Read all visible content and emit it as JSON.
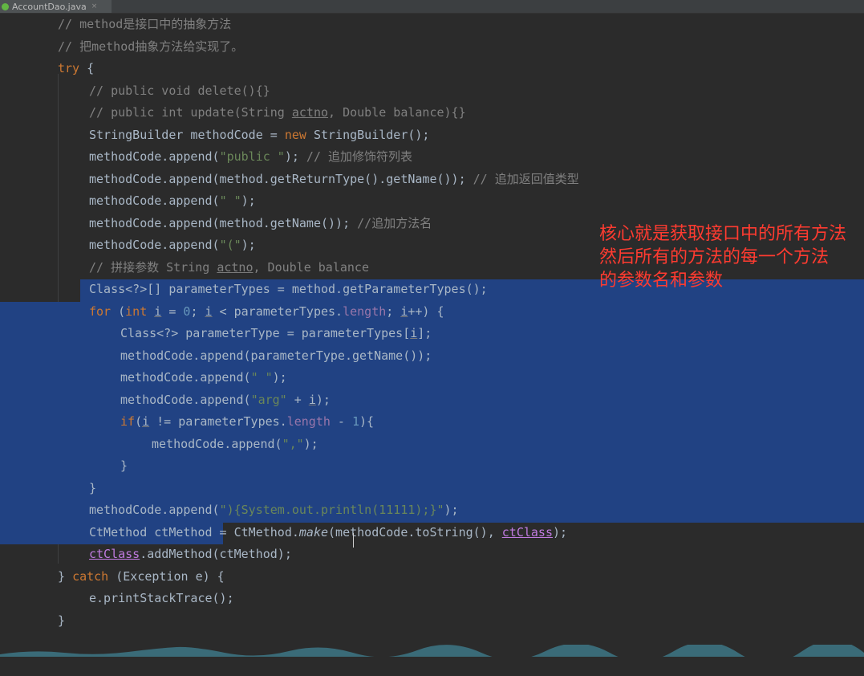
{
  "tab": {
    "filename": "AccountDao.java",
    "close": "×"
  },
  "annotation": {
    "line1": "核心就是获取接口中的所有方法",
    "line2": "然后所有的方法的每一个方法",
    "line3": "的参数名和参数"
  },
  "code": {
    "l01": "// method是接口中的抽象方法",
    "l02": "// 把method抽象方法给实现了。",
    "l03_kw": "try",
    "l03_rest": " {",
    "l04": "// public void delete(){}",
    "l05_a": "// public int update(String ",
    "l05_b": "actno",
    "l05_c": ", Double balance){}",
    "l06_a": "StringBuilder methodCode = ",
    "l06_kw": "new",
    "l06_b": " StringBuilder();",
    "l07_a": "methodCode.append(",
    "l07_str": "\"public \"",
    "l07_b": ");",
    "l07_cm": " // 追加修饰符列表",
    "l08_a": "methodCode.append(method.getReturnType().getName());",
    "l08_cm": " // 追加返回值类型",
    "l09_a": "methodCode.append(",
    "l09_str": "\" \"",
    "l09_b": ");",
    "l10_a": "methodCode.append(method.getName());",
    "l10_cm": " //追加方法名",
    "l11_a": "methodCode.append(",
    "l11_str": "\"(\"",
    "l11_b": ");",
    "l12_a": "// 拼接参数 String ",
    "l12_b": "actno",
    "l12_c": ", Double balance",
    "l13": "Class<?>[] parameterTypes = method.getParameterTypes();",
    "l14_kw": "for",
    "l14_a": " (",
    "l14_kw2": "int",
    "l14_b": " ",
    "l14_i1": "i",
    "l14_c": " = ",
    "l14_n": "0",
    "l14_d": "; ",
    "l14_i2": "i",
    "l14_e": " < parameterTypes.",
    "l14_f": "length",
    "l14_g": "; ",
    "l14_i3": "i",
    "l14_h": "++) {",
    "l15_a": "Class<?> parameterType = parameterTypes[",
    "l15_i": "i",
    "l15_b": "];",
    "l16": "methodCode.append(parameterType.getName());",
    "l17_a": "methodCode.append(",
    "l17_str": "\" \"",
    "l17_b": ");",
    "l18_a": "methodCode.append(",
    "l18_str": "\"arg\"",
    "l18_b": " + ",
    "l18_i": "i",
    "l18_c": ");",
    "l19_kw": "if",
    "l19_a": "(",
    "l19_i": "i",
    "l19_b": " != parameterTypes.",
    "l19_f": "length",
    "l19_c": " - ",
    "l19_n": "1",
    "l19_d": "){",
    "l20_a": "methodCode.append(",
    "l20_str": "\",\"",
    "l20_b": ");",
    "l21": "}",
    "l22": "}",
    "l23_a": "methodCode.append(",
    "l23_str": "\"){System.out.println(11111);}\"",
    "l23_b": ");",
    "l24_a": "CtMethod ctMethod = CtMethod.",
    "l24_it": "make",
    "l24_b": "(methodCode.toString(), ",
    "l24_c": "ctClass",
    "l24_d": ");",
    "l25_a": "ctClass",
    "l25_b": ".addMethod(ctMethod);",
    "l26_a": "} ",
    "l26_kw": "catch",
    "l26_b": " (Exception e) {",
    "l27": "e.printStackTrace();",
    "l28": "}"
  }
}
